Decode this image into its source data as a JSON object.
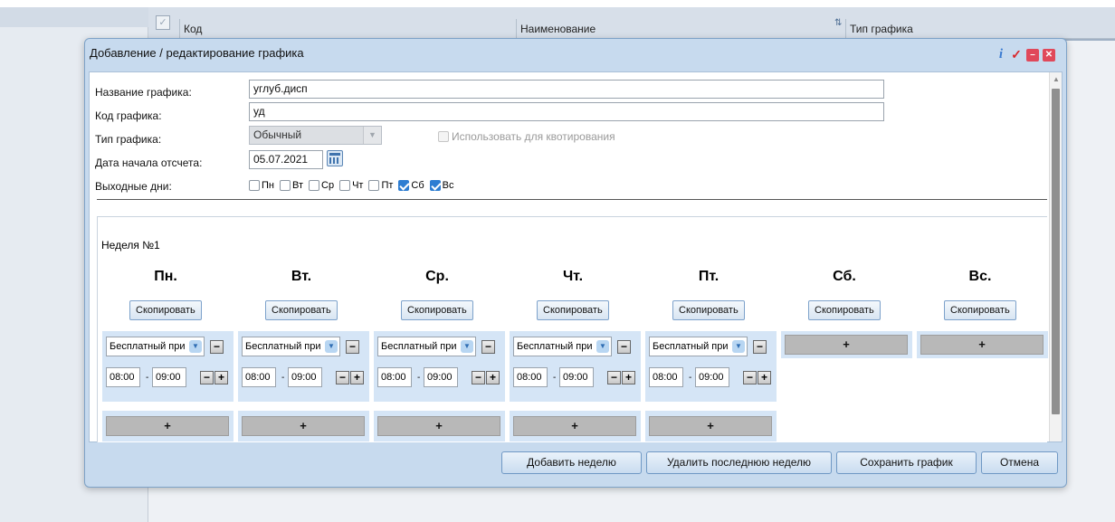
{
  "background": {
    "columns": [
      "Код",
      "Наименование",
      "Тип графика"
    ]
  },
  "dialog": {
    "title": "Добавление / редактирование графика",
    "title_icons": [
      "info-icon",
      "check-icon",
      "minimize-icon",
      "close-icon"
    ]
  },
  "form": {
    "name_label": "Название графика:",
    "name_value": "углуб.дисп",
    "code_label": "Код графика:",
    "code_value": "уд",
    "type_label": "Тип графика:",
    "type_value": "Обычный",
    "quota_label": "Использовать для квотирования",
    "start_date_label": "Дата начала отсчета:",
    "start_date_value": "05.07.2021",
    "days_off_label": "Выходные дни:",
    "days_off": [
      {
        "label": "Пн",
        "checked": false
      },
      {
        "label": "Вт",
        "checked": false
      },
      {
        "label": "Ср",
        "checked": false
      },
      {
        "label": "Чт",
        "checked": false
      },
      {
        "label": "Пт",
        "checked": false
      },
      {
        "label": "Сб",
        "checked": true
      },
      {
        "label": "Вс",
        "checked": true
      }
    ]
  },
  "week": {
    "label": "Неделя №1",
    "copy_label": "Скопировать",
    "add_symbol": "+",
    "minus_symbol": "−",
    "days": [
      {
        "name": "Пн.",
        "service": "Бесплатный при",
        "start": "08:00",
        "end": "09:00"
      },
      {
        "name": "Вт.",
        "service": "Бесплатный при",
        "start": "08:00",
        "end": "09:00"
      },
      {
        "name": "Ср.",
        "service": "Бесплатный при",
        "start": "08:00",
        "end": "09:00"
      },
      {
        "name": "Чт.",
        "service": "Бесплатный при",
        "start": "08:00",
        "end": "09:00"
      },
      {
        "name": "Пт.",
        "service": "Бесплатный при",
        "start": "08:00",
        "end": "09:00"
      },
      {
        "name": "Сб."
      },
      {
        "name": "Вс."
      }
    ],
    "time_separator": "-"
  },
  "footer": {
    "add_week": "Добавить неделю",
    "remove_last_week": "Удалить последнюю неделю",
    "save": "Сохранить график",
    "cancel": "Отмена"
  }
}
